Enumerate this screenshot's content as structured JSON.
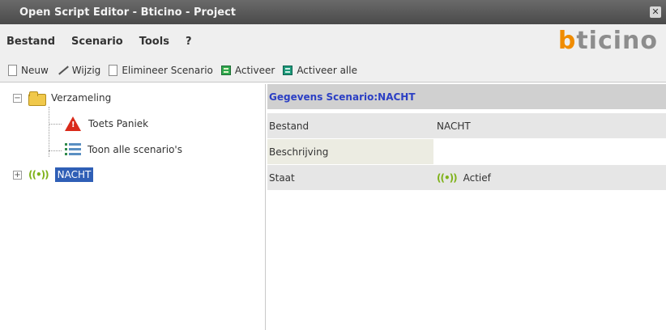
{
  "window": {
    "title": "Open Script Editor - Bticino - Project",
    "close_glyph": "✕"
  },
  "menu": {
    "items": [
      "Bestand",
      "Scenario",
      "Tools",
      "?"
    ]
  },
  "brand": {
    "logo_first": "b",
    "logo_rest": "ticino",
    "accent_color": "#f08c00"
  },
  "toolbar": {
    "new_label": "Neuw",
    "edit_label": "Wijzig",
    "delete_label": "Elimineer Scenario",
    "activate_label": "Activeer",
    "activate_all_label": "Activeer alle"
  },
  "tree": {
    "root_label": "Verzameling",
    "root_expander": "−",
    "children": [
      "Toets Paniek",
      "Toon alle scenario's"
    ],
    "scenario_label": "NACHT",
    "scenario_expander": "+",
    "scenario_icon": "((•))"
  },
  "details": {
    "header": "Gegevens Scenario:NACHT",
    "rows": [
      {
        "key": "Bestand",
        "value": "NACHT"
      },
      {
        "key": "Beschrijving",
        "value": ""
      },
      {
        "key": "Staat",
        "value": "Actief"
      }
    ]
  }
}
